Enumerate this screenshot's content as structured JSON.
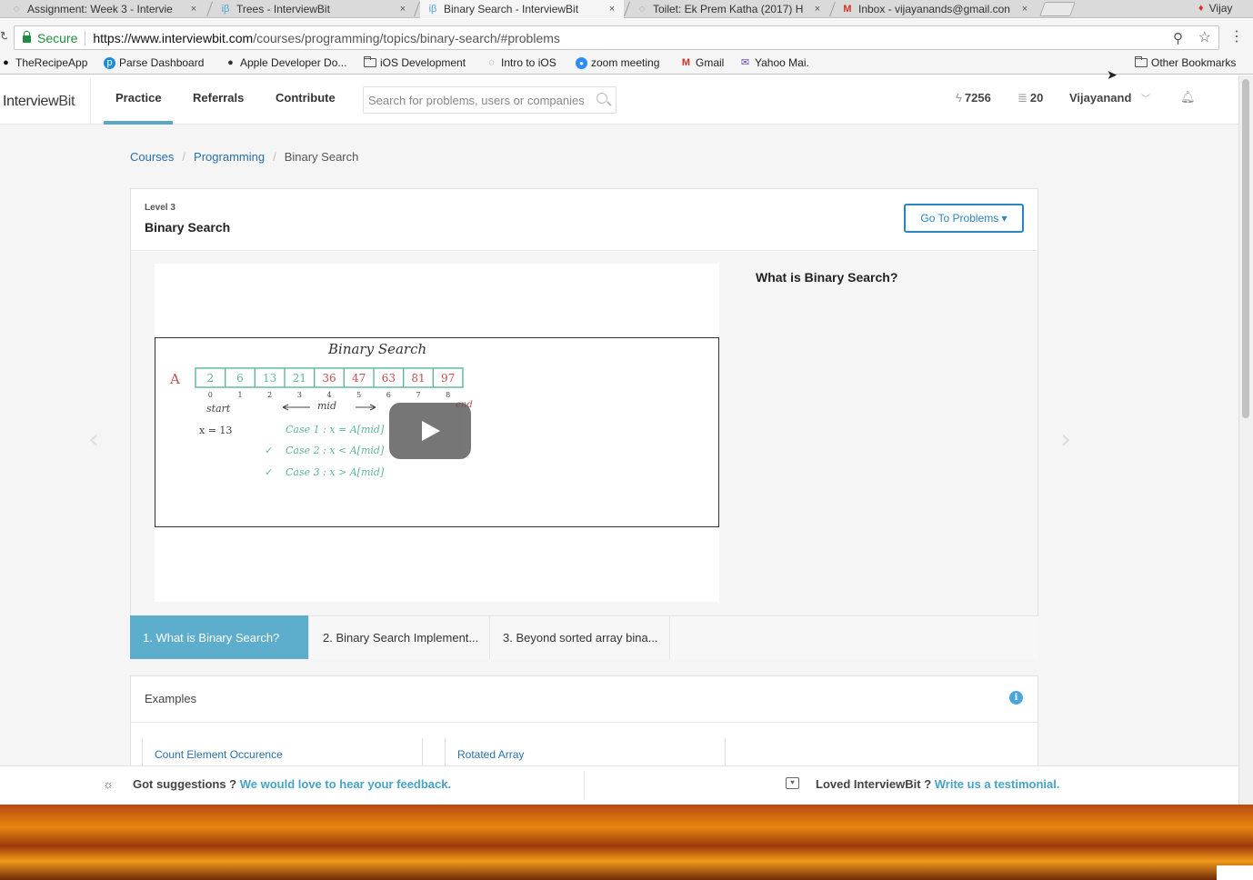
{
  "browser": {
    "tabs": [
      {
        "title": "Assignment: Week 3 - Intervie",
        "icon": "loading-spinner-icon"
      },
      {
        "title": "Trees - InterviewBit",
        "icon": "ib-icon"
      },
      {
        "title": "Binary Search - InterviewBit",
        "icon": "ib-icon"
      },
      {
        "title": "Toilet: Ek Prem Katha (2017) H",
        "icon": "loading-spinner-icon"
      },
      {
        "title": "Inbox - vijayanands@gmail.con",
        "icon": "gmail-icon"
      }
    ],
    "close_glyph": "×",
    "profile_name": "Vijay",
    "secure_label": "Secure",
    "url_host": "https://www.interviewbit.com",
    "url_path": "/courses/programming/topics/binary-search/#problems",
    "bookmarks": [
      {
        "label": "TheRecipeApp",
        "icon": "github-icon"
      },
      {
        "label": "Parse Dashboard",
        "icon": "parse-icon"
      },
      {
        "label": "Apple Developer Do...",
        "icon": "apple-icon"
      },
      {
        "label": "iOS Development",
        "icon": "folder-icon"
      },
      {
        "label": "Intro to iOS",
        "icon": "loading-spinner-icon"
      },
      {
        "label": "zoom meeting",
        "icon": "zoom-icon"
      },
      {
        "label": "Gmail",
        "icon": "gmail-icon"
      },
      {
        "label": "Yahoo Mai.",
        "icon": "yahoo-mail-icon"
      }
    ],
    "other_bookmarks": "Other Bookmarks"
  },
  "site": {
    "logo_left": "Interview",
    "logo_right": "Bit",
    "nav": [
      "Practice",
      "Referrals",
      "Contribute"
    ],
    "search_placeholder": "Search for problems, users or companies",
    "score": "7256",
    "coins": "20",
    "username": "Vijayanand"
  },
  "breadcrumb": {
    "items": [
      "Courses",
      "Programming"
    ],
    "separator": "/",
    "current": "Binary Search"
  },
  "topic": {
    "level": "Level 3",
    "title": "Binary Search",
    "go_to_button": "Go To Problems ▾",
    "section_heading": "What is Binary Search?",
    "tabs": [
      "1. What is Binary Search?",
      "2. Binary Search Implement...",
      "3. Beyond sorted array bina..."
    ]
  },
  "video": {
    "title": "Binary Search",
    "array_label": "A",
    "array_values": [
      "2",
      "6",
      "13",
      "21",
      "36",
      "47",
      "63",
      "81",
      "97"
    ],
    "indices": [
      "0",
      "1",
      "2",
      "3",
      "4",
      "5",
      "6",
      "7",
      "8"
    ],
    "start_label": "start",
    "mid_label": "mid",
    "end_label": "end",
    "x_label": "x = 13",
    "cases": [
      "Case 1 :  x = A[mid]",
      "Case 2 :  x < A[mid]",
      "Case 3 :  x > A[mid]"
    ]
  },
  "examples": {
    "title": "Examples",
    "items": [
      "Count Element Occurence",
      "Rotated Array"
    ]
  },
  "footer": {
    "left_text": "Got suggestions ? ",
    "left_link": "We would love to hear your feedback.",
    "right_text": "Loved InterviewBit ? ",
    "right_link": "Write us a testimonial."
  },
  "colors": {
    "accent": "#5daecd",
    "link": "#2a6fa8",
    "button_blue": "#2a84c2",
    "secure_green": "#1e8e3e"
  }
}
